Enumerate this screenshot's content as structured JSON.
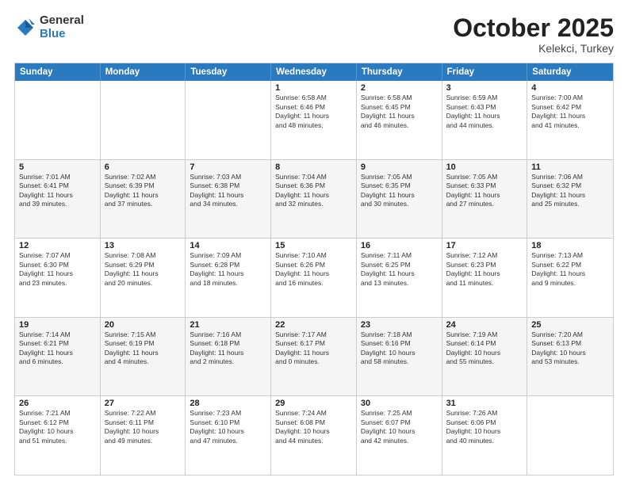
{
  "logo": {
    "general": "General",
    "blue": "Blue"
  },
  "header": {
    "month": "October 2025",
    "location": "Kelekci, Turkey"
  },
  "weekdays": [
    "Sunday",
    "Monday",
    "Tuesday",
    "Wednesday",
    "Thursday",
    "Friday",
    "Saturday"
  ],
  "rows": [
    [
      {
        "day": "",
        "lines": [],
        "alt": false
      },
      {
        "day": "",
        "lines": [],
        "alt": false
      },
      {
        "day": "",
        "lines": [],
        "alt": false
      },
      {
        "day": "1",
        "lines": [
          "Sunrise: 6:58 AM",
          "Sunset: 6:46 PM",
          "Daylight: 11 hours",
          "and 48 minutes."
        ],
        "alt": false
      },
      {
        "day": "2",
        "lines": [
          "Sunrise: 6:58 AM",
          "Sunset: 6:45 PM",
          "Daylight: 11 hours",
          "and 46 minutes."
        ],
        "alt": false
      },
      {
        "day": "3",
        "lines": [
          "Sunrise: 6:59 AM",
          "Sunset: 6:43 PM",
          "Daylight: 11 hours",
          "and 44 minutes."
        ],
        "alt": false
      },
      {
        "day": "4",
        "lines": [
          "Sunrise: 7:00 AM",
          "Sunset: 6:42 PM",
          "Daylight: 11 hours",
          "and 41 minutes."
        ],
        "alt": false
      }
    ],
    [
      {
        "day": "5",
        "lines": [
          "Sunrise: 7:01 AM",
          "Sunset: 6:41 PM",
          "Daylight: 11 hours",
          "and 39 minutes."
        ],
        "alt": true
      },
      {
        "day": "6",
        "lines": [
          "Sunrise: 7:02 AM",
          "Sunset: 6:39 PM",
          "Daylight: 11 hours",
          "and 37 minutes."
        ],
        "alt": true
      },
      {
        "day": "7",
        "lines": [
          "Sunrise: 7:03 AM",
          "Sunset: 6:38 PM",
          "Daylight: 11 hours",
          "and 34 minutes."
        ],
        "alt": true
      },
      {
        "day": "8",
        "lines": [
          "Sunrise: 7:04 AM",
          "Sunset: 6:36 PM",
          "Daylight: 11 hours",
          "and 32 minutes."
        ],
        "alt": true
      },
      {
        "day": "9",
        "lines": [
          "Sunrise: 7:05 AM",
          "Sunset: 6:35 PM",
          "Daylight: 11 hours",
          "and 30 minutes."
        ],
        "alt": true
      },
      {
        "day": "10",
        "lines": [
          "Sunrise: 7:05 AM",
          "Sunset: 6:33 PM",
          "Daylight: 11 hours",
          "and 27 minutes."
        ],
        "alt": true
      },
      {
        "day": "11",
        "lines": [
          "Sunrise: 7:06 AM",
          "Sunset: 6:32 PM",
          "Daylight: 11 hours",
          "and 25 minutes."
        ],
        "alt": true
      }
    ],
    [
      {
        "day": "12",
        "lines": [
          "Sunrise: 7:07 AM",
          "Sunset: 6:30 PM",
          "Daylight: 11 hours",
          "and 23 minutes."
        ],
        "alt": false
      },
      {
        "day": "13",
        "lines": [
          "Sunrise: 7:08 AM",
          "Sunset: 6:29 PM",
          "Daylight: 11 hours",
          "and 20 minutes."
        ],
        "alt": false
      },
      {
        "day": "14",
        "lines": [
          "Sunrise: 7:09 AM",
          "Sunset: 6:28 PM",
          "Daylight: 11 hours",
          "and 18 minutes."
        ],
        "alt": false
      },
      {
        "day": "15",
        "lines": [
          "Sunrise: 7:10 AM",
          "Sunset: 6:26 PM",
          "Daylight: 11 hours",
          "and 16 minutes."
        ],
        "alt": false
      },
      {
        "day": "16",
        "lines": [
          "Sunrise: 7:11 AM",
          "Sunset: 6:25 PM",
          "Daylight: 11 hours",
          "and 13 minutes."
        ],
        "alt": false
      },
      {
        "day": "17",
        "lines": [
          "Sunrise: 7:12 AM",
          "Sunset: 6:23 PM",
          "Daylight: 11 hours",
          "and 11 minutes."
        ],
        "alt": false
      },
      {
        "day": "18",
        "lines": [
          "Sunrise: 7:13 AM",
          "Sunset: 6:22 PM",
          "Daylight: 11 hours",
          "and 9 minutes."
        ],
        "alt": false
      }
    ],
    [
      {
        "day": "19",
        "lines": [
          "Sunrise: 7:14 AM",
          "Sunset: 6:21 PM",
          "Daylight: 11 hours",
          "and 6 minutes."
        ],
        "alt": true
      },
      {
        "day": "20",
        "lines": [
          "Sunrise: 7:15 AM",
          "Sunset: 6:19 PM",
          "Daylight: 11 hours",
          "and 4 minutes."
        ],
        "alt": true
      },
      {
        "day": "21",
        "lines": [
          "Sunrise: 7:16 AM",
          "Sunset: 6:18 PM",
          "Daylight: 11 hours",
          "and 2 minutes."
        ],
        "alt": true
      },
      {
        "day": "22",
        "lines": [
          "Sunrise: 7:17 AM",
          "Sunset: 6:17 PM",
          "Daylight: 11 hours",
          "and 0 minutes."
        ],
        "alt": true
      },
      {
        "day": "23",
        "lines": [
          "Sunrise: 7:18 AM",
          "Sunset: 6:16 PM",
          "Daylight: 10 hours",
          "and 58 minutes."
        ],
        "alt": true
      },
      {
        "day": "24",
        "lines": [
          "Sunrise: 7:19 AM",
          "Sunset: 6:14 PM",
          "Daylight: 10 hours",
          "and 55 minutes."
        ],
        "alt": true
      },
      {
        "day": "25",
        "lines": [
          "Sunrise: 7:20 AM",
          "Sunset: 6:13 PM",
          "Daylight: 10 hours",
          "and 53 minutes."
        ],
        "alt": true
      }
    ],
    [
      {
        "day": "26",
        "lines": [
          "Sunrise: 7:21 AM",
          "Sunset: 6:12 PM",
          "Daylight: 10 hours",
          "and 51 minutes."
        ],
        "alt": false
      },
      {
        "day": "27",
        "lines": [
          "Sunrise: 7:22 AM",
          "Sunset: 6:11 PM",
          "Daylight: 10 hours",
          "and 49 minutes."
        ],
        "alt": false
      },
      {
        "day": "28",
        "lines": [
          "Sunrise: 7:23 AM",
          "Sunset: 6:10 PM",
          "Daylight: 10 hours",
          "and 47 minutes."
        ],
        "alt": false
      },
      {
        "day": "29",
        "lines": [
          "Sunrise: 7:24 AM",
          "Sunset: 6:08 PM",
          "Daylight: 10 hours",
          "and 44 minutes."
        ],
        "alt": false
      },
      {
        "day": "30",
        "lines": [
          "Sunrise: 7:25 AM",
          "Sunset: 6:07 PM",
          "Daylight: 10 hours",
          "and 42 minutes."
        ],
        "alt": false
      },
      {
        "day": "31",
        "lines": [
          "Sunrise: 7:26 AM",
          "Sunset: 6:06 PM",
          "Daylight: 10 hours",
          "and 40 minutes."
        ],
        "alt": false
      },
      {
        "day": "",
        "lines": [],
        "alt": false
      }
    ]
  ]
}
